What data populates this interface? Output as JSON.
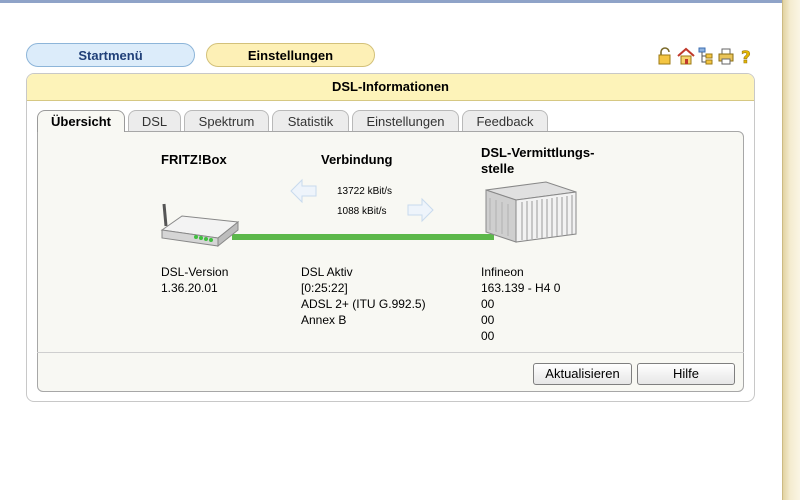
{
  "menu": {
    "start_label": "Startmenü",
    "settings_label": "Einstellungen"
  },
  "toolbar_icons": [
    "lock-icon",
    "home-icon",
    "sitemap-icon",
    "printer-icon",
    "help-icon"
  ],
  "panel": {
    "title": "DSL-Informationen"
  },
  "tabs": [
    {
      "label": "Übersicht",
      "active": true
    },
    {
      "label": "DSL"
    },
    {
      "label": "Spektrum"
    },
    {
      "label": "Statistik"
    },
    {
      "label": "Einstellungen"
    },
    {
      "label": "Feedback"
    }
  ],
  "overview": {
    "device_heading": "FRITZ!Box",
    "connection_heading": "Verbindung",
    "exchange_heading_line1": "DSL-Vermittlungs-",
    "exchange_heading_line2": "stelle",
    "upstream": "13722 kBit/s",
    "downstream": "1088 kBit/s",
    "device_info": [
      "DSL-Version",
      "1.36.20.01"
    ],
    "connection_info": [
      "DSL Aktiv",
      "[0:25:22]",
      "ADSL 2+ (ITU G.992.5)",
      "Annex B"
    ],
    "exchange_info": [
      "Infineon",
      "163.139 - H4 0",
      "00",
      "00",
      "00"
    ]
  },
  "colors": {
    "link_line": "#5cb84a",
    "panel_header": "#fdf3b9",
    "start_button": "#dcecfa",
    "settings_button": "#fdf0b6"
  },
  "buttons": {
    "refresh_label": "Aktualisieren",
    "help_label": "Hilfe"
  }
}
